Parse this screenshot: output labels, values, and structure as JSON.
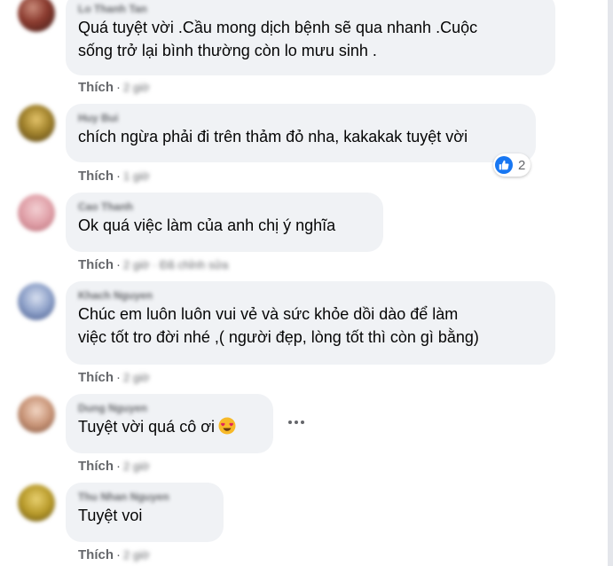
{
  "like_label": "Thích",
  "separator": "·",
  "reaction_count": "2",
  "comments": [
    {
      "author": "Lo Thanh Tan",
      "lines": [
        "Quá tuyệt vời .Cầu mong dịch bệnh sẽ qua nhanh .Cuộc",
        "sống trở lại bình thường còn lo mưu sinh ."
      ],
      "time": "2 giờ"
    },
    {
      "author": "Huy Bui",
      "lines": [
        "chích ngừa phải đi trên thảm đỏ nha, kakakak tuyệt vời"
      ],
      "time": "1 giờ"
    },
    {
      "author": "Cao Thanh",
      "lines": [
        "Ok quá việc làm của anh chị ý nghĩa"
      ],
      "time": "2 giờ · Đã chỉnh sửa"
    },
    {
      "author": "Khach Nguyen",
      "lines": [
        "Chúc em luôn luôn vui vẻ và sức khỏe dồi dào để làm",
        "việc tốt tro đời nhé ,( người đẹp, lòng tốt thì còn gì bằng)"
      ],
      "time": "2 giờ"
    },
    {
      "author": "Dung Nguyen",
      "lines": [
        "Tuyệt vời quá cô ơi"
      ],
      "time": "2 giờ"
    },
    {
      "author": "Thu Nhan Nguyen",
      "lines": [
        "Tuyệt voi"
      ],
      "time": "2 giờ"
    }
  ],
  "colors": {
    "bubble": "#f0f2f5",
    "like_blue": "#1877f2",
    "secondary_text": "#65676b"
  },
  "icons": {
    "reaction": "like-icon",
    "emoji": "heart-eyes-emoji-icon",
    "more": "more-options-icon"
  }
}
